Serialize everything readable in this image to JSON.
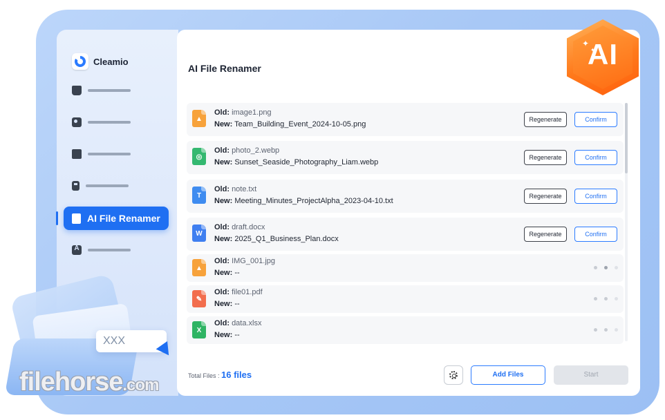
{
  "brand": {
    "name": "Cleamio"
  },
  "sidebar": {
    "items": [
      {
        "icon": "broom-icon"
      },
      {
        "icon": "image-icon"
      },
      {
        "icon": "folder-icon"
      },
      {
        "icon": "archive-icon"
      },
      {
        "icon": "ai-file-icon",
        "label": "AI File Renamer",
        "active": true
      },
      {
        "icon": "app-store-icon"
      }
    ]
  },
  "main": {
    "title": "AI File Renamer",
    "old_label": "Old:",
    "new_label": "New:",
    "regenerate_label": "Regenerate",
    "confirm_label": "Confirm",
    "files": [
      {
        "type": "image",
        "icon": "image-file-icon",
        "old": "image1.png",
        "new": "Team_Building_Event_2024-10-05.png",
        "status": "done"
      },
      {
        "type": "webp",
        "icon": "webp-file-icon",
        "old": "photo_2.webp",
        "new": "Sunset_Seaside_Photography_Liam.webp",
        "status": "done"
      },
      {
        "type": "text",
        "icon": "text-file-icon",
        "old": "note.txt",
        "new": "Meeting_Minutes_ProjectAlpha_2023-04-10.txt",
        "status": "done"
      },
      {
        "type": "word",
        "icon": "word-file-icon",
        "old": "draft.docx",
        "new": "2025_Q1_Business_Plan.docx",
        "status": "done"
      },
      {
        "type": "image",
        "icon": "image-file-icon",
        "old": "IMG_001.jpg",
        "new": "--",
        "status": "loading"
      },
      {
        "type": "pdf",
        "icon": "pdf-file-icon",
        "old": "file01.pdf",
        "new": "--",
        "status": "loading"
      },
      {
        "type": "excel",
        "icon": "excel-file-icon",
        "old": "data.xlsx",
        "new": "--",
        "status": "loading"
      }
    ]
  },
  "footer": {
    "total_label": "Total Files :",
    "total_value": "16 files",
    "add_files_label": "Add Files",
    "start_label": "Start"
  },
  "badge": {
    "text": "AI"
  },
  "illustration": {
    "card_text": "XXX"
  },
  "watermark": {
    "text": "filehorse",
    "suffix": ".com"
  },
  "colors": {
    "accent": "#1f6ff2",
    "badge": "#ff7a1c",
    "frame": "#a8c8f6"
  }
}
